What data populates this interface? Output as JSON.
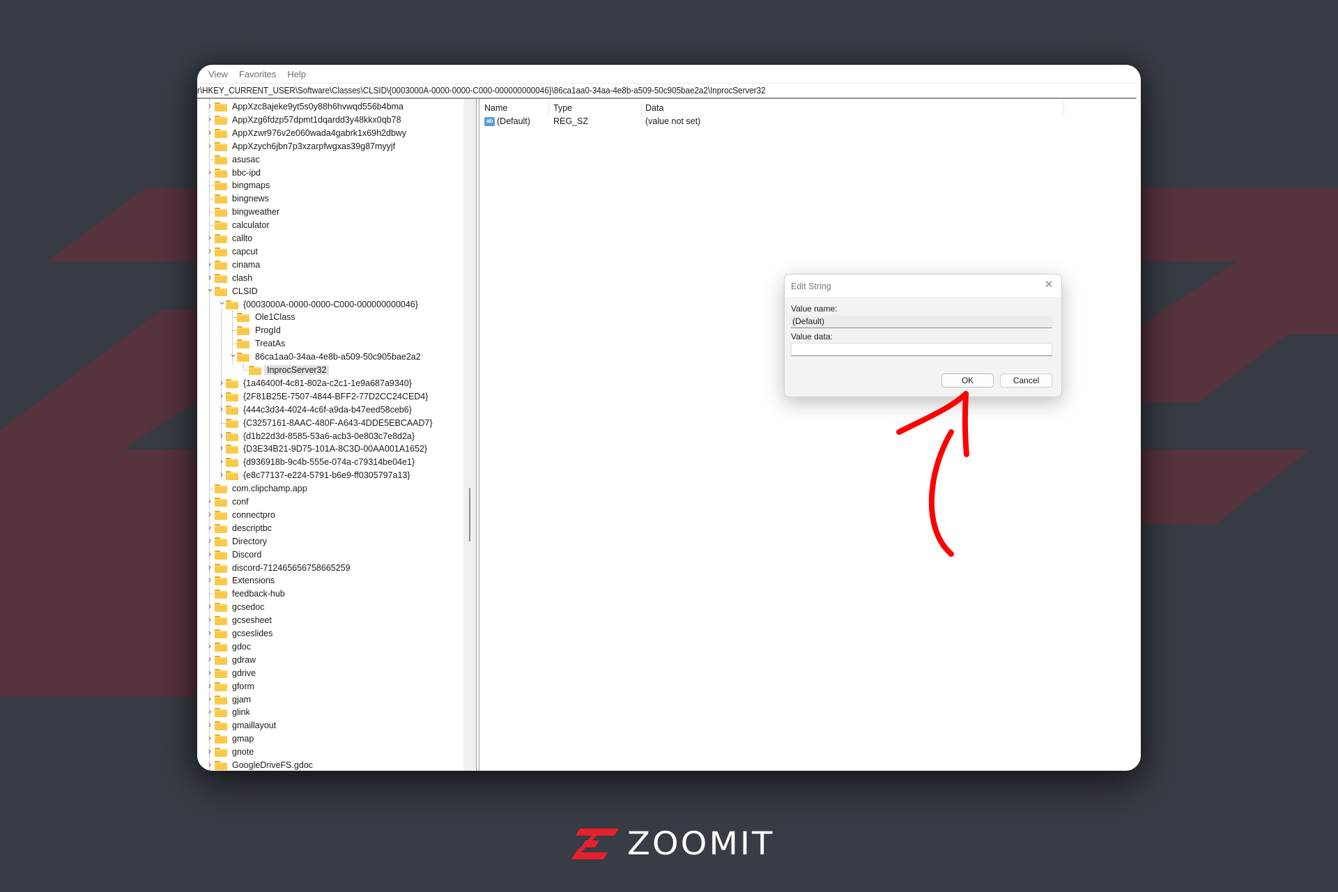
{
  "menu": [
    "View",
    "Favorites",
    "Help"
  ],
  "address": "r\\HKEY_CURRENT_USER\\Software\\Classes\\CLSID\\{0003000A-0000-0000-C000-000000000046}\\86ca1aa0-34aa-4e8b-a509-50c905bae2a2\\InprocServer32",
  "tree": [
    {
      "label": "AppXzc8ajeke9yt5s0y88h6hvwqd556b4bma",
      "level": 0,
      "expander": "collapsed"
    },
    {
      "label": "AppXzg6fdzp57dpmt1dqardd3y48kkx0qb78",
      "level": 0,
      "expander": "collapsed"
    },
    {
      "label": "AppXzwr976v2e060wada4gabrk1x69h2dbwy",
      "level": 0,
      "expander": "collapsed"
    },
    {
      "label": "AppXzych6jbn7p3xzarpfwgxas39g87myyjf",
      "level": 0,
      "expander": "collapsed"
    },
    {
      "label": "asusac",
      "level": 0,
      "expander": "none"
    },
    {
      "label": "bbc-ipd",
      "level": 0,
      "expander": "collapsed"
    },
    {
      "label": "bingmaps",
      "level": 0,
      "expander": "none"
    },
    {
      "label": "bingnews",
      "level": 0,
      "expander": "none"
    },
    {
      "label": "bingweather",
      "level": 0,
      "expander": "none"
    },
    {
      "label": "calculator",
      "level": 0,
      "expander": "none"
    },
    {
      "label": "callto",
      "level": 0,
      "expander": "collapsed"
    },
    {
      "label": "capcut",
      "level": 0,
      "expander": "collapsed"
    },
    {
      "label": "cinama",
      "level": 0,
      "expander": "collapsed"
    },
    {
      "label": "clash",
      "level": 0,
      "expander": "collapsed"
    },
    {
      "label": "CLSID",
      "level": 0,
      "expander": "expanded"
    },
    {
      "label": "{0003000A-0000-0000-C000-000000000046}",
      "level": 1,
      "expander": "expanded"
    },
    {
      "label": "Ole1Class",
      "level": 2,
      "expander": "none"
    },
    {
      "label": "ProgId",
      "level": 2,
      "expander": "none"
    },
    {
      "label": "TreatAs",
      "level": 2,
      "expander": "none"
    },
    {
      "label": "86ca1aa0-34aa-4e8b-a509-50c905bae2a2",
      "level": 2,
      "expander": "expanded"
    },
    {
      "label": "InprocServer32",
      "level": 3,
      "expander": "none",
      "selected": true
    },
    {
      "label": "{1a46400f-4c81-802a-c2c1-1e9a687a9340}",
      "level": 1,
      "expander": "collapsed"
    },
    {
      "label": "{2F81B25E-7507-4844-BFF2-77D2CC24CED4}",
      "level": 1,
      "expander": "collapsed"
    },
    {
      "label": "{444c3d34-4024-4c6f-a9da-b47eed58ceb6}",
      "level": 1,
      "expander": "collapsed"
    },
    {
      "label": "{C3257161-8AAC-480F-A643-4DDE5EBCAAD7}",
      "level": 1,
      "expander": "none"
    },
    {
      "label": "{d1b22d3d-8585-53a6-acb3-0e803c7e8d2a}",
      "level": 1,
      "expander": "collapsed"
    },
    {
      "label": "{D3E34B21-9D75-101A-8C3D-00AA001A1652}",
      "level": 1,
      "expander": "collapsed"
    },
    {
      "label": "{d936918b-9c4b-555e-074a-c79314be04e1}",
      "level": 1,
      "expander": "collapsed"
    },
    {
      "label": "{e8c77137-e224-5791-b6e9-ff0305797a13}",
      "level": 1,
      "expander": "collapsed"
    },
    {
      "label": "com.clipchamp.app",
      "level": 0,
      "expander": "none"
    },
    {
      "label": "conf",
      "level": 0,
      "expander": "collapsed"
    },
    {
      "label": "connectpro",
      "level": 0,
      "expander": "collapsed"
    },
    {
      "label": "descriptbc",
      "level": 0,
      "expander": "collapsed"
    },
    {
      "label": "Directory",
      "level": 0,
      "expander": "collapsed"
    },
    {
      "label": "Discord",
      "level": 0,
      "expander": "collapsed"
    },
    {
      "label": "discord-712465656758665259",
      "level": 0,
      "expander": "collapsed"
    },
    {
      "label": "Extensions",
      "level": 0,
      "expander": "collapsed"
    },
    {
      "label": "feedback-hub",
      "level": 0,
      "expander": "none"
    },
    {
      "label": "gcsedoc",
      "level": 0,
      "expander": "collapsed"
    },
    {
      "label": "gcsesheet",
      "level": 0,
      "expander": "collapsed"
    },
    {
      "label": "gcseslides",
      "level": 0,
      "expander": "collapsed"
    },
    {
      "label": "gdoc",
      "level": 0,
      "expander": "collapsed"
    },
    {
      "label": "gdraw",
      "level": 0,
      "expander": "collapsed"
    },
    {
      "label": "gdrive",
      "level": 0,
      "expander": "collapsed"
    },
    {
      "label": "gform",
      "level": 0,
      "expander": "collapsed"
    },
    {
      "label": "gjam",
      "level": 0,
      "expander": "collapsed"
    },
    {
      "label": "glink",
      "level": 0,
      "expander": "collapsed"
    },
    {
      "label": "gmaillayout",
      "level": 0,
      "expander": "collapsed"
    },
    {
      "label": "gmap",
      "level": 0,
      "expander": "collapsed"
    },
    {
      "label": "gnote",
      "level": 0,
      "expander": "collapsed"
    },
    {
      "label": "GoogleDriveFS.gdoc",
      "level": 0,
      "expander": "collapsed"
    }
  ],
  "values_pane": {
    "columns": [
      "Name",
      "Type",
      "Data"
    ],
    "rows": [
      {
        "icon": "string-value-icon",
        "icon_text": "ab",
        "name": "(Default)",
        "type": "REG_SZ",
        "data": "(value not set)"
      }
    ]
  },
  "dialog": {
    "title": "Edit String",
    "close_glyph": "✕",
    "value_name_label": "Value name:",
    "value_name": "(Default)",
    "value_data_label": "Value data:",
    "value_data": "",
    "ok_label": "OK",
    "cancel_label": "Cancel"
  },
  "annotation": {
    "type": "hand-drawn-arrow",
    "points_to": "OK button",
    "color": "#ff0000"
  },
  "brand": {
    "name": "ZOOMIT",
    "accent": "#e8202e",
    "background": "#383c44",
    "stripe": "#57333d"
  }
}
